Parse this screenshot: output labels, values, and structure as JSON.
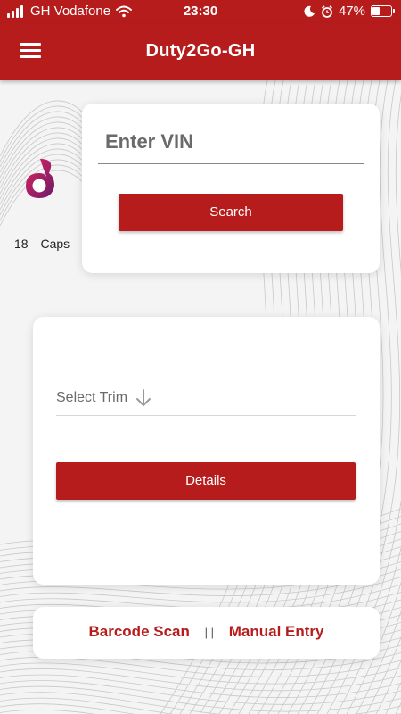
{
  "status_bar": {
    "carrier": "GH Vodafone",
    "time": "23:30",
    "battery_percent": "47%",
    "battery_level": 0.47,
    "icons": [
      "signal-icon",
      "wifi-icon",
      "moon-icon",
      "alarm-icon",
      "battery-icon"
    ]
  },
  "app_bar": {
    "title": "Duty2Go-GH",
    "menu_icon": "hamburger-menu-icon"
  },
  "caps": {
    "count": "18",
    "label": "Caps",
    "logo_icon": "app-logo"
  },
  "vin_card": {
    "input_placeholder": "Enter VIN",
    "input_value": "",
    "search_label": "Search"
  },
  "trim_card": {
    "select_label": "Select Trim",
    "arrow_icon": "arrow-down-icon",
    "details_label": "Details"
  },
  "bottom_bar": {
    "barcode_label": "Barcode Scan",
    "separator": "| |",
    "manual_label": "Manual Entry"
  },
  "colors": {
    "primary": "#b71c1c",
    "background": "#f4f4f4",
    "card": "#ffffff"
  }
}
